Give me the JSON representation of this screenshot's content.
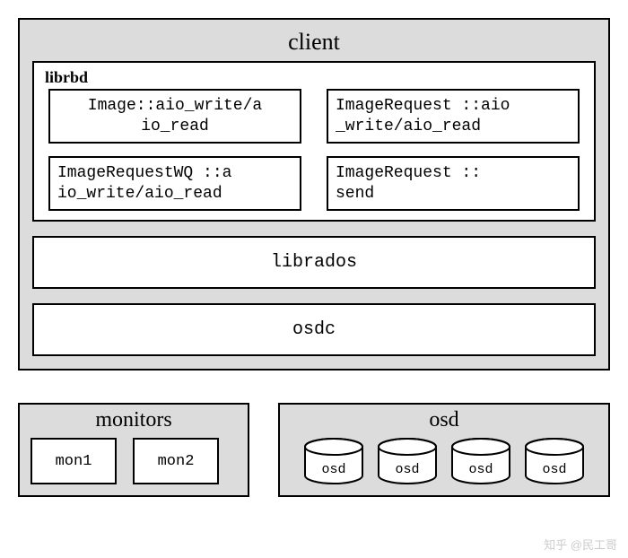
{
  "client": {
    "title": "client",
    "librbd": {
      "title": "librbd",
      "boxes": [
        {
          "text": "Image::aio_write/a\nio_read"
        },
        {
          "text": "ImageRequest ::aio\n_write/aio_read"
        },
        {
          "text": "ImageRequestWQ ::a\nio_write/aio_read"
        },
        {
          "text": "ImageRequest ::\nsend"
        }
      ]
    },
    "librados": "librados",
    "osdc": "osdc"
  },
  "monitors": {
    "title": "monitors",
    "items": [
      "mon1",
      "mon2"
    ]
  },
  "osd": {
    "title": "osd",
    "items": [
      "osd",
      "osd",
      "osd",
      "osd"
    ]
  },
  "watermark": "知乎 @民工哥"
}
